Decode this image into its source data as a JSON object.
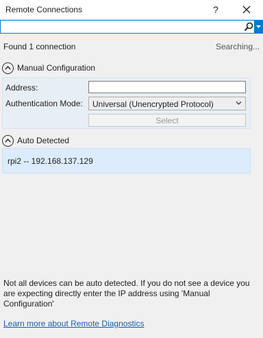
{
  "window": {
    "title": "Remote Connections",
    "help_label": "?",
    "close_label": "✕"
  },
  "search": {
    "placeholder": "",
    "value": "",
    "accent_color": "#007acc"
  },
  "status": {
    "found": "Found 1 connection",
    "searching": "Searching..."
  },
  "manual": {
    "header": "Manual Configuration",
    "address_label": "Address:",
    "address_value": "",
    "auth_label": "Authentication Mode:",
    "auth_value": "Universal (Unencrypted Protocol)",
    "select_label": "Select"
  },
  "auto": {
    "header": "Auto Detected",
    "devices": [
      "rpi2 -- 192.168.137.129"
    ]
  },
  "footer": {
    "note": "Not all devices can be auto detected. If you do not see a device you are expecting directly enter the IP address using 'Manual Configuration'",
    "learn_more": "Learn more about Remote Diagnostics"
  }
}
